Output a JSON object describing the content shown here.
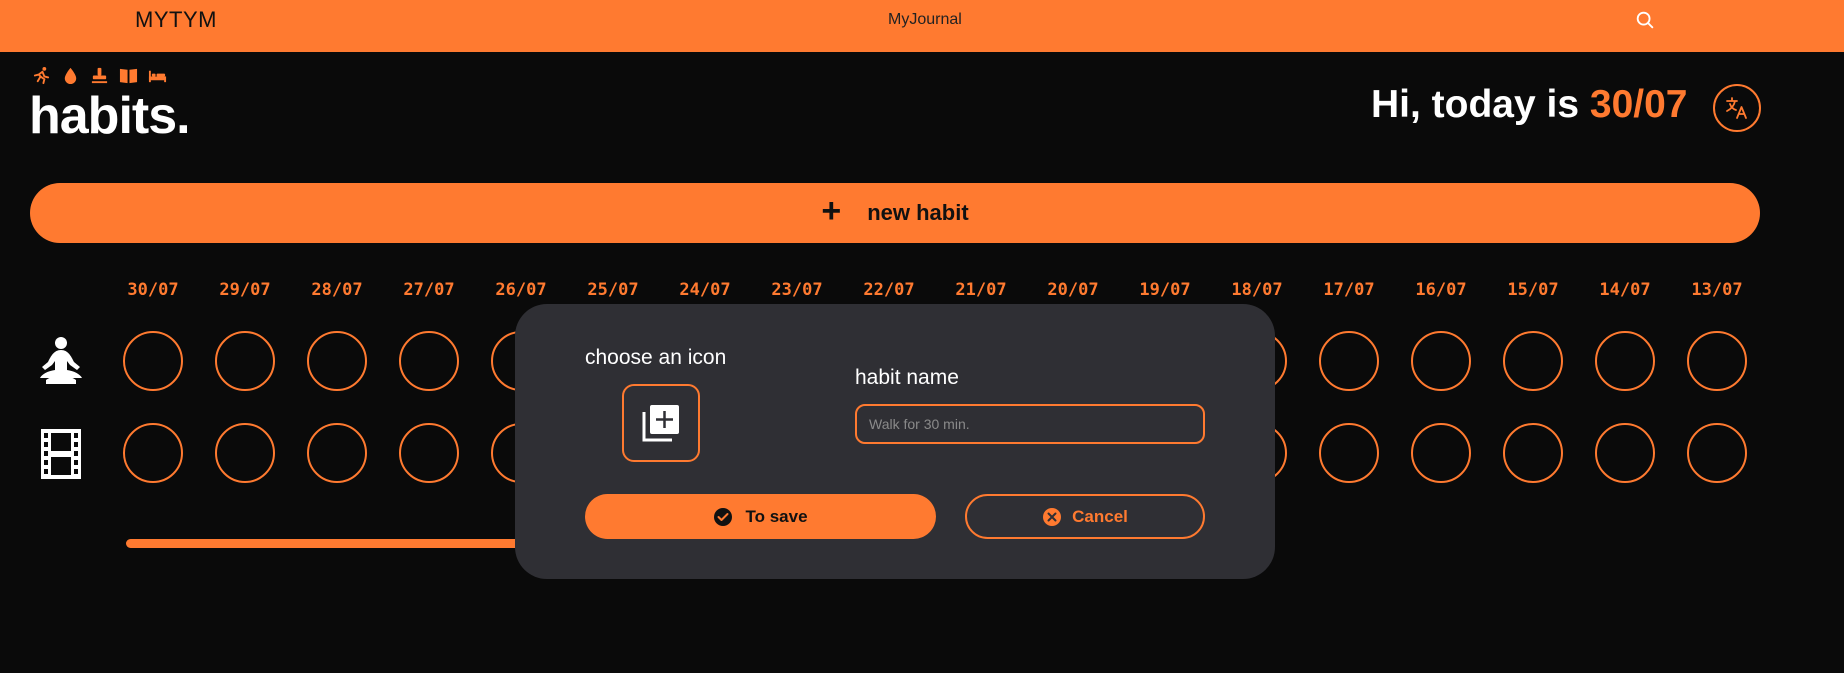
{
  "app": {
    "brand": "MYTYM",
    "nav_link": "MyJournal"
  },
  "header": {
    "title": "habits.",
    "greeting_prefix": "Hi, today is ",
    "today": "30/07",
    "category_icons": [
      "running-icon",
      "water-drop-icon",
      "stamp-icon",
      "book-icon",
      "bed-icon"
    ]
  },
  "actions": {
    "new_habit": "new habit"
  },
  "tracker": {
    "dates": [
      "30/07",
      "29/07",
      "28/07",
      "27/07",
      "26/07",
      "25/07",
      "24/07",
      "23/07",
      "22/07",
      "21/07",
      "20/07",
      "19/07",
      "18/07",
      "17/07",
      "16/07",
      "15/07",
      "14/07",
      "13/07"
    ],
    "habits": [
      {
        "icon": "meditation-icon",
        "completed": [
          false,
          false,
          false,
          false,
          false,
          false,
          false,
          false,
          false,
          false,
          false,
          false,
          false,
          false,
          false,
          false,
          false,
          false
        ]
      },
      {
        "icon": "film-icon",
        "completed": [
          false,
          false,
          false,
          false,
          false,
          false,
          false,
          false,
          false,
          false,
          false,
          false,
          false,
          false,
          false,
          false,
          false,
          false
        ]
      }
    ]
  },
  "modal": {
    "choose_icon_label": "choose an icon",
    "habit_name_label": "habit name",
    "habit_name_placeholder": "Walk for 30 min.",
    "habit_name_value": "",
    "save_label": "To save",
    "cancel_label": "Cancel"
  },
  "colors": {
    "accent": "#ff7a30",
    "background": "#0a0a0a",
    "modal": "#2f2f34"
  }
}
